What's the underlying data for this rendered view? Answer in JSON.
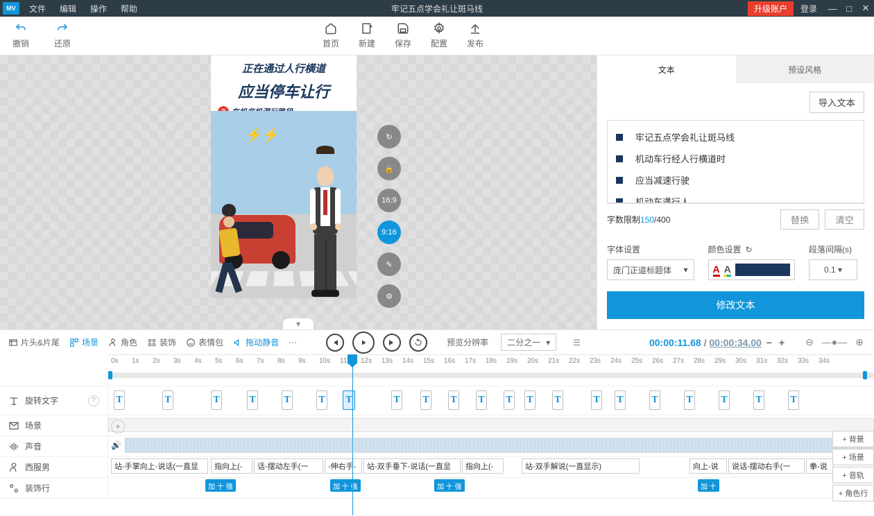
{
  "titlebar": {
    "logo": "MV",
    "menu": [
      "文件",
      "编辑",
      "操作",
      "帮助"
    ],
    "title": "牢记五点学会礼让斑马线",
    "upgrade": "升级账户",
    "login": "登录"
  },
  "toolbar": {
    "undo": "撤销",
    "redo": "还原",
    "home": "首页",
    "new": "新建",
    "save": "保存",
    "config": "配置",
    "publish": "发布"
  },
  "canvas": {
    "line1": "正在通过人行横道",
    "line2": "应当停车让行",
    "badge": "3",
    "sub": "在机非机混行路段"
  },
  "stageTools": {
    "t1": "↻",
    "t2": "🔒",
    "t3": "16:9",
    "t4": "9:16",
    "t5": "✎",
    "t6": "⚙"
  },
  "rightPanel": {
    "tabs": [
      "文本",
      "预设风格"
    ],
    "import": "导入文本",
    "lines": [
      "牢记五点学会礼让斑马线",
      "机动车行经人行横道时",
      "应当减速行驶",
      "机动车遇行人"
    ],
    "countLabel": "字数限制",
    "countCur": "150",
    "countMax": " /400",
    "replace": "替换",
    "clear": "清空",
    "fontLabel": "字体设置",
    "colorLabel": "颜色设置",
    "paraLabel": "段落间隔(s)",
    "font": "庞门正道标题体",
    "para": "0.1",
    "modify": "修改文本"
  },
  "timelineHeader": {
    "items": [
      {
        "label": "片头&片尾",
        "blue": false
      },
      {
        "label": "场景",
        "blue": true
      },
      {
        "label": "角色",
        "blue": false
      },
      {
        "label": "装饰",
        "blue": false
      },
      {
        "label": "表情包",
        "blue": false
      },
      {
        "label": "拖动静音",
        "blue": true
      }
    ],
    "preview": "预览分辨率",
    "previewVal": "二分之一",
    "timeCur": "00:00:11.68",
    "timeTot": "00:00:34.00"
  },
  "tracks": {
    "rotate": "旋转文字",
    "scene": "场景",
    "sound": "声音",
    "male": "西服男",
    "deco": "装饰行",
    "addBtns": [
      "+ 背景",
      "+ 场景",
      "+ 音轨",
      "+ 角色行"
    ],
    "clips": [
      "站-手掌向上-说话(一直显",
      "指向上(-",
      "话-摆动左手(一",
      "-伸右手-",
      "站-双手垂下-说话(一直显",
      "指向上(-",
      "站-双手解说(一直显示)",
      "向上-说",
      "说话-摆动右手(一",
      "拳-说"
    ],
    "chips": [
      "加 十 强",
      "加 十 强",
      "加 十 强",
      "加 十"
    ]
  },
  "ruler": {
    "start": 0,
    "end": 34
  }
}
